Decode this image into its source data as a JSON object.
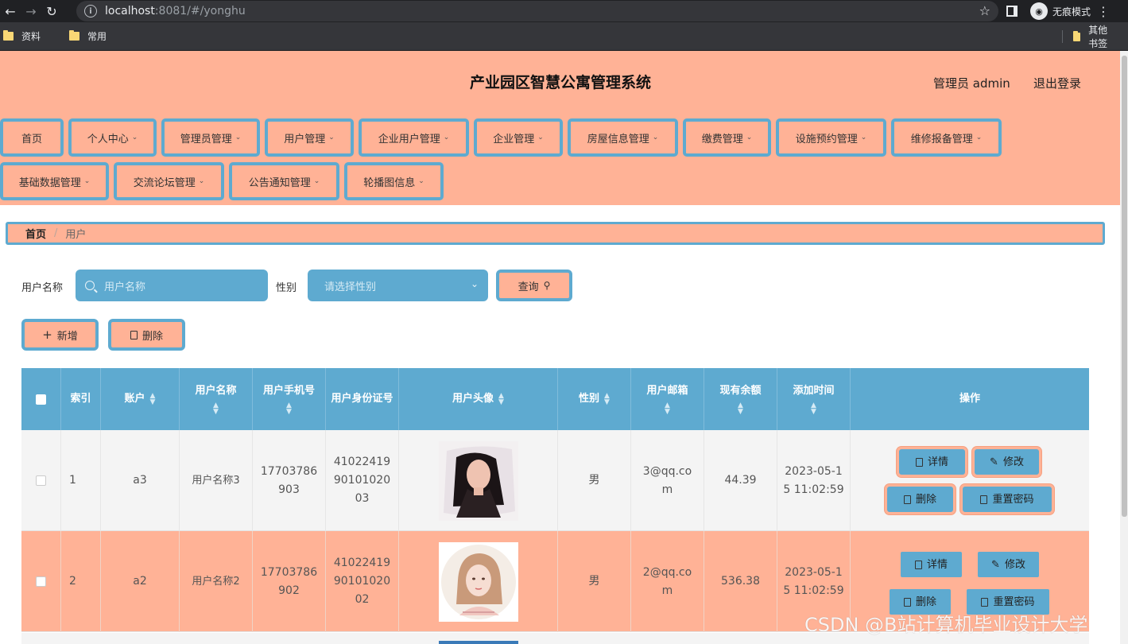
{
  "browser": {
    "url_host": "localhost",
    "url_rest": ":8081/#/yonghu",
    "incognito_label": "无痕模式",
    "bookmarks": [
      "资料",
      "常用"
    ],
    "other_bookmarks": "其他书签"
  },
  "header": {
    "title": "产业园区智慧公寓管理系统",
    "admin_label": "管理员 admin",
    "logout_label": "退出登录"
  },
  "menu": {
    "items": [
      "首页",
      "个人中心",
      "管理员管理",
      "用户管理",
      "企业用户管理",
      "企业管理",
      "房屋信息管理",
      "缴费管理",
      "设施预约管理",
      "维修报备管理",
      "基础数据管理",
      "交流论坛管理",
      "公告通知管理",
      "轮播图信息"
    ]
  },
  "breadcrumb": {
    "home": "首页",
    "current": "用户"
  },
  "search": {
    "name_label": "用户名称",
    "name_placeholder": "用户名称",
    "gender_label": "性别",
    "gender_placeholder": "请选择性别",
    "query_label": "查询"
  },
  "toolbar": {
    "add_label": "新增",
    "delete_label": "删除"
  },
  "table": {
    "headers": {
      "index": "索引",
      "account": "账户",
      "name": "用户名称",
      "phone": "用户手机号",
      "idcard": "用户身份证号",
      "avatar": "用户头像",
      "gender": "性别",
      "email": "用户邮箱",
      "balance": "现有余额",
      "added": "添加时间",
      "ops": "操作"
    },
    "rows": [
      {
        "index": "1",
        "account": "a3",
        "name": "用户名称3",
        "phone_a": "17703786",
        "phone_b": "903",
        "idcard_a": "41022419",
        "idcard_b": "90101020",
        "idcard_c": "03",
        "gender": "男",
        "email_a": "3@qq.co",
        "email_b": "m",
        "balance": "44.39",
        "added_a": "2023-05-1",
        "added_b": "5 11:02:59"
      },
      {
        "index": "2",
        "account": "a2",
        "name": "用户名称2",
        "phone_a": "17703786",
        "phone_b": "902",
        "idcard_a": "41022419",
        "idcard_b": "90101020",
        "idcard_c": "02",
        "gender": "男",
        "email_a": "2@qq.co",
        "email_b": "m",
        "balance": "536.38",
        "added_a": "2023-05-1",
        "added_b": "5 11:02:59"
      }
    ],
    "ops": {
      "detail": "详情",
      "edit": "修改",
      "delete": "删除",
      "reset": "重置密码"
    }
  },
  "watermark": "CSDN @B站计算机毕业设计大学",
  "colors": {
    "accent_blue": "#5eaad0",
    "accent_salmon": "#ffb296"
  }
}
